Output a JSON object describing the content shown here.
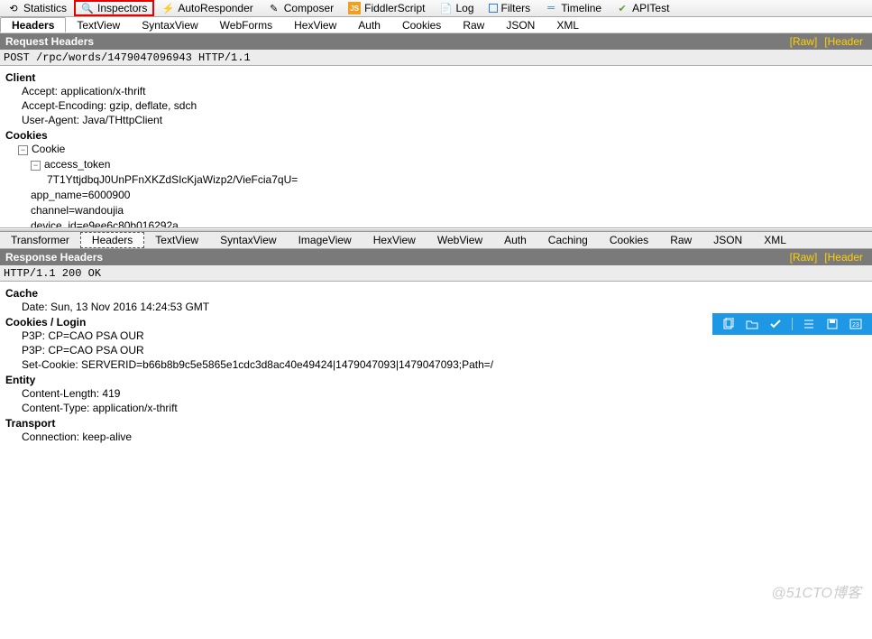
{
  "mainTabs": [
    {
      "label": "Statistics",
      "icon": "⟲"
    },
    {
      "label": "Inspectors",
      "icon": "🔍",
      "hl": true
    },
    {
      "label": "AutoResponder",
      "icon": "⚡"
    },
    {
      "label": "Composer",
      "icon": "✎"
    },
    {
      "label": "FiddlerScript",
      "icon": "JS"
    },
    {
      "label": "Log",
      "icon": "📄"
    },
    {
      "label": "Filters",
      "icon": "□"
    },
    {
      "label": "Timeline",
      "icon": "═"
    },
    {
      "label": "APITest",
      "icon": "✔"
    }
  ],
  "reqSubTabs": [
    "Headers",
    "TextView",
    "SyntaxView",
    "WebForms",
    "HexView",
    "Auth",
    "Cookies",
    "Raw",
    "JSON",
    "XML"
  ],
  "reqSubActive": "Headers",
  "reqSection": {
    "title": "Request Headers",
    "links": [
      "[Raw]",
      "[Header"
    ]
  },
  "reqRaw": "POST /rpc/words/1479047096943 HTTP/1.1",
  "reqTree": {
    "client": {
      "cat": "Client",
      "items": [
        "Accept: application/x-thrift",
        "Accept-Encoding: gzip, deflate, sdch",
        "User-Agent: Java/THttpClient"
      ]
    },
    "cookies": {
      "cat": "Cookies",
      "node": "Cookie",
      "sub": "access_token",
      "sub_val": "7T1YttjdbqJ0UnPFnXKZdSIcKjaWizp2/VieFcia7qU=",
      "rest": [
        "app_name=6000900",
        "channel=wandoujia",
        "device_id=e9ee6c80b016292a"
      ]
    }
  },
  "resTabs": [
    "Transformer",
    "Headers",
    "TextView",
    "SyntaxView",
    "ImageView",
    "HexView",
    "WebView",
    "Auth",
    "Caching",
    "Cookies",
    "Raw",
    "JSON",
    "XML"
  ],
  "resActive": "Headers",
  "resSection": {
    "title": "Response Headers",
    "links": [
      "[Raw]",
      "[Header"
    ]
  },
  "resRaw": "HTTP/1.1 200 OK",
  "resTree": {
    "cache": {
      "cat": "Cache",
      "items": [
        "Date: Sun, 13 Nov 2016 14:24:53 GMT"
      ]
    },
    "cookies": {
      "cat": "Cookies / Login",
      "items": [
        "P3P: CP=CAO PSA OUR",
        "P3P: CP=CAO PSA OUR",
        "Set-Cookie: SERVERID=b66b8b9c5e5865e1cdc3d8ac40e49424|1479047093|1479047093;Path=/"
      ]
    },
    "entity": {
      "cat": "Entity",
      "items": [
        "Content-Length: 419",
        "Content-Type: application/x-thrift"
      ]
    },
    "transport": {
      "cat": "Transport",
      "items": [
        "Connection: keep-alive"
      ]
    }
  },
  "watermark": "@51CTO博客"
}
